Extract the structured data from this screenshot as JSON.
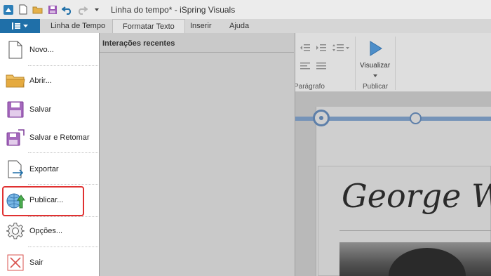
{
  "window": {
    "title": "Linha do tempo* - iSpring Visuals"
  },
  "quick_access": [
    {
      "name": "app-logo-icon"
    },
    {
      "name": "new-file-icon"
    },
    {
      "name": "open-folder-icon"
    },
    {
      "name": "save-icon"
    },
    {
      "name": "undo-icon"
    },
    {
      "name": "redo-icon"
    },
    {
      "name": "customize-dropdown-icon"
    }
  ],
  "ribbon": {
    "tabs": [
      "Linha de Tempo",
      "Formatar Texto",
      "Inserir",
      "Ajuda"
    ],
    "active_tab": "Formatar Texto",
    "groups": {
      "paragraph_label": "Parágrafo",
      "publish_label": "Publicar",
      "preview_label": "Visualizar"
    }
  },
  "recent_panel": {
    "title": "Interações recentes"
  },
  "menu": {
    "items": [
      {
        "label": "Novo...",
        "icon": "new-document-icon"
      },
      {
        "label": "Abrir...",
        "icon": "open-folder-icon"
      },
      {
        "label": "Salvar",
        "icon": "save-icon"
      },
      {
        "label": "Salvar e Retomar",
        "icon": "save-and-return-icon"
      },
      {
        "label": "Exportar",
        "icon": "export-icon"
      },
      {
        "label": "Publicar...",
        "icon": "publish-globe-icon"
      },
      {
        "label": "Opções...",
        "icon": "gear-icon"
      },
      {
        "label": "Sair",
        "icon": "close-icon"
      }
    ],
    "highlighted_item": "Publicar..."
  },
  "slide": {
    "heading": "George Washington"
  },
  "colors": {
    "accent": "#1f6fa8",
    "timeline": "#7593b8",
    "highlight": "#e03131"
  }
}
